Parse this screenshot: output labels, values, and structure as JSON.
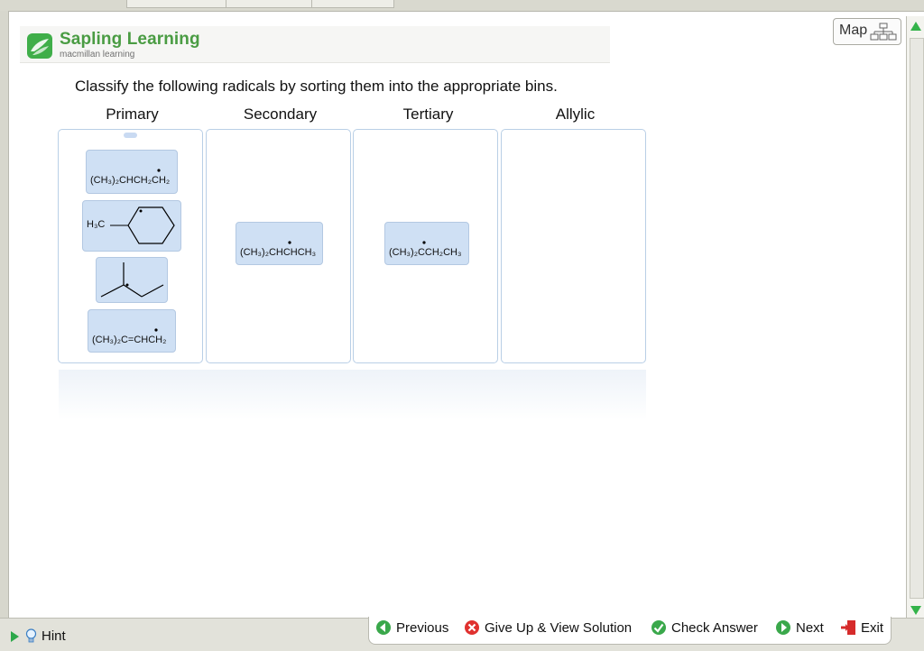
{
  "header": {
    "brand_name": "Sapling Learning",
    "brand_sub": "macmillan learning"
  },
  "map": {
    "label": "Map"
  },
  "question": {
    "text": "Classify the following radicals by sorting them into the appropriate bins."
  },
  "bins": [
    {
      "label": "Primary"
    },
    {
      "label": "Secondary"
    },
    {
      "label": "Tertiary"
    },
    {
      "label": "Allylic"
    }
  ],
  "tiles": {
    "primary_1": "(CH₃)₂CHCH₂CH₂",
    "primary_2_label": "H₃C",
    "primary_4": "(CH₃)₂C=CHCH₂",
    "secondary_1": "(CH₃)₂CHCHCH₃",
    "tertiary_1": "(CH₃)₂CCH₂CH₃"
  },
  "footer": {
    "hint": "Hint",
    "previous": "Previous",
    "give_up": "Give Up & View Solution",
    "check": "Check Answer",
    "next": "Next",
    "exit": "Exit"
  },
  "colors": {
    "brand_green": "#4a9c43",
    "tile_blue": "#cfe0f4",
    "bin_border": "#b9cfe6"
  }
}
